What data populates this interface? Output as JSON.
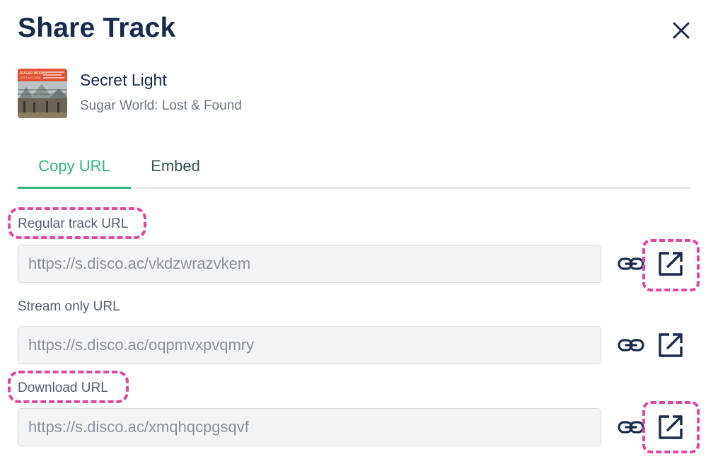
{
  "dialog": {
    "title": "Share Track",
    "close_icon": "close-icon"
  },
  "track": {
    "name": "Secret Light",
    "album": "Sugar World: Lost & Found",
    "cover_text": "SUGAR WORLD",
    "cover_subtext": "LOST & FOUND"
  },
  "tabs": [
    {
      "label": "Copy URL",
      "active": true
    },
    {
      "label": "Embed",
      "active": false
    }
  ],
  "fields": [
    {
      "label": "Regular track URL",
      "value": "https://s.disco.ac/vkdzwrazvkem",
      "copy_icon": "link-icon",
      "open_icon": "open-external-icon",
      "highlighted_label": true,
      "highlighted_open": true
    },
    {
      "label": "Stream only URL",
      "value": "https://s.disco.ac/oqpmvxpvqmry",
      "copy_icon": "link-icon",
      "open_icon": "open-external-icon",
      "highlighted_label": false,
      "highlighted_open": false
    },
    {
      "label": "Download URL",
      "value": "https://s.disco.ac/xmqhqcpgsqvf",
      "copy_icon": "link-icon",
      "open_icon": "open-external-icon",
      "highlighted_label": true,
      "highlighted_open": true
    }
  ],
  "colors": {
    "title": "#172a4d",
    "accent_active_tab": "#2fb57a",
    "highlight": "#e0479e",
    "input_bg": "#f3f4f5",
    "icon": "#1b2b4b"
  }
}
